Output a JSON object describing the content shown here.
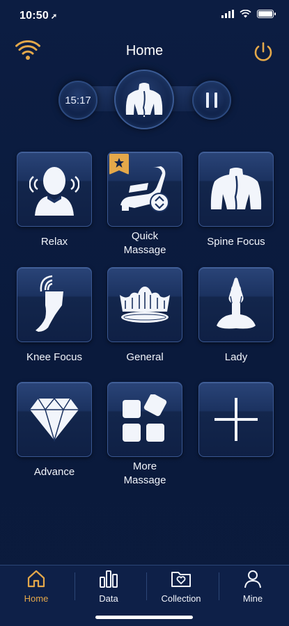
{
  "status_bar": {
    "time": "10:50"
  },
  "header": {
    "title": "Home"
  },
  "control": {
    "timer": "15:17"
  },
  "tiles": [
    {
      "label": "Relax",
      "icon": "head-massage-icon"
    },
    {
      "label": "Quick Massage",
      "icon": "massage-chair-icon",
      "starred": true
    },
    {
      "label": "Spine Focus",
      "icon": "spine-back-icon"
    },
    {
      "label": "Knee Focus",
      "icon": "knee-leg-icon"
    },
    {
      "label": "General",
      "icon": "crown-icon"
    },
    {
      "label": "Lady",
      "icon": "meditation-lady-icon"
    },
    {
      "label": "Advance",
      "icon": "diamond-icon"
    },
    {
      "label": "More Massage",
      "icon": "grid-blocks-icon"
    },
    {
      "label": "",
      "icon": "plus-icon"
    }
  ],
  "tab_bar": {
    "items": [
      {
        "label": "Home",
        "icon": "home-icon",
        "active": true
      },
      {
        "label": "Data",
        "icon": "bar-chart-icon"
      },
      {
        "label": "Collection",
        "icon": "folder-heart-icon"
      },
      {
        "label": "Mine",
        "icon": "user-icon"
      }
    ]
  },
  "colors": {
    "accent": "#e4a84a",
    "background": "#0b1a3a",
    "tile_border": "#3a5893"
  }
}
